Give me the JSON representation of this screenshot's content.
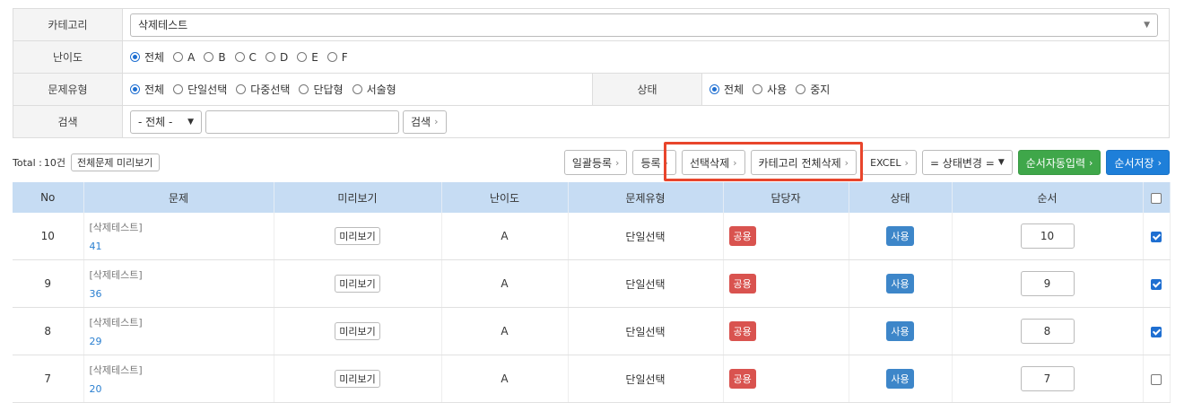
{
  "filters": {
    "category_label": "카테고리",
    "category_value": "삭제테스트",
    "difficulty_label": "난이도",
    "difficulty_options": [
      "전체",
      "A",
      "B",
      "C",
      "D",
      "E",
      "F"
    ],
    "type_label": "문제유형",
    "type_options": [
      "전체",
      "단일선택",
      "다중선택",
      "단답형",
      "서술형"
    ],
    "status_label": "상태",
    "status_options": [
      "전체",
      "사용",
      "중지"
    ],
    "search_label": "검색",
    "search_select": "- 전체 -",
    "search_value": "",
    "search_button": "검색"
  },
  "toolbar": {
    "total_prefix": "Total :",
    "total_count": "10건",
    "preview_all": "전체문제 미리보기",
    "bulk_register": "일괄등록",
    "register": "등록",
    "delete_selected": "선택삭제",
    "delete_category_all": "카테고리 전체삭제",
    "excel": "EXCEL",
    "status_change": "= 상태변경 =",
    "auto_order": "순서자동입력",
    "save_order": "순서저장"
  },
  "table": {
    "headers": [
      "No",
      "문제",
      "미리보기",
      "난이도",
      "문제유형",
      "담당자",
      "상태",
      "순서"
    ],
    "rows": [
      {
        "no": "10",
        "category": "[삭제테스트]",
        "id": "41",
        "preview": "미리보기",
        "difficulty": "A",
        "type": "단일선택",
        "owner": "공용",
        "status": "사용",
        "order": "10",
        "checked": true
      },
      {
        "no": "9",
        "category": "[삭제테스트]",
        "id": "36",
        "preview": "미리보기",
        "difficulty": "A",
        "type": "단일선택",
        "owner": "공용",
        "status": "사용",
        "order": "9",
        "checked": true
      },
      {
        "no": "8",
        "category": "[삭제테스트]",
        "id": "29",
        "preview": "미리보기",
        "difficulty": "A",
        "type": "단일선택",
        "owner": "공용",
        "status": "사용",
        "order": "8",
        "checked": true
      },
      {
        "no": "7",
        "category": "[삭제테스트]",
        "id": "20",
        "preview": "미리보기",
        "difficulty": "A",
        "type": "단일선택",
        "owner": "공용",
        "status": "사용",
        "order": "7",
        "checked": false
      }
    ]
  },
  "colors": {
    "highlight": "#e8452c",
    "header_bg": "#c6dcf3",
    "green": "#3fa74a",
    "blue": "#1e7fd9"
  }
}
